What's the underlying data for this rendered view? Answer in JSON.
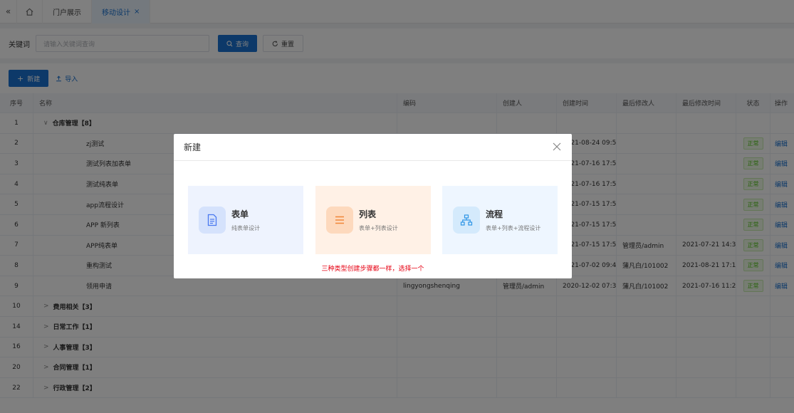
{
  "tabs": {
    "collapse_glyph": "«",
    "items": [
      {
        "label": "门户展示"
      },
      {
        "label": "移动设计",
        "close": "×"
      }
    ]
  },
  "search": {
    "label": "关键词",
    "placeholder": "请输入关键词查询",
    "query_button": "查询",
    "reset_button": "重置"
  },
  "actions": {
    "new_button": "新建",
    "import_link": "导入"
  },
  "table": {
    "headers": [
      "序号",
      "名称",
      "编码",
      "创建人",
      "创建时间",
      "最后修改人",
      "最后修改时间",
      "状态",
      "操作"
    ],
    "rows": [
      {
        "no": "1",
        "name": "仓库管理【8】",
        "type": "group",
        "expanded": true
      },
      {
        "no": "2",
        "name": "zj测试",
        "type": "child",
        "created": "2021-08-24 09:54",
        "status": "正常",
        "op": "编辑"
      },
      {
        "no": "3",
        "name": "测试列表加表单",
        "type": "child",
        "created": "2021-07-16 17:55",
        "status": "正常",
        "op": "编辑"
      },
      {
        "no": "4",
        "name": "测试纯表单",
        "type": "child",
        "created": "2021-07-16 17:54",
        "status": "正常",
        "op": "编辑"
      },
      {
        "no": "5",
        "name": "app流程设计",
        "type": "child",
        "created": "2021-07-15 17:58",
        "status": "正常",
        "op": "编辑"
      },
      {
        "no": "6",
        "name": "APP 新列表",
        "type": "child",
        "created": "2021-07-15 17:57",
        "status": "正常",
        "op": "编辑"
      },
      {
        "no": "7",
        "name": "APP纯表单",
        "type": "child",
        "created": "2021-07-15 17:56",
        "modifier": "管理员/admin",
        "modified": "2021-07-21 14:31",
        "status": "正常",
        "op": "编辑"
      },
      {
        "no": "8",
        "name": "重构测试",
        "type": "child",
        "created": "2021-07-02 09:40",
        "modifier": "蒲凡白/101002",
        "modified": "2021-08-21 17:11",
        "status": "正常",
        "op": "编辑"
      },
      {
        "no": "9",
        "name": "领用申请",
        "type": "child",
        "code": "lingyongshenqing",
        "creator": "管理员/admin",
        "created": "2020-12-02 07:39",
        "modifier": "蒲凡白/101002",
        "modified": "2021-07-16 11:26",
        "status": "正常",
        "op": "编辑"
      },
      {
        "no": "10",
        "name": "费用相关【3】",
        "type": "group"
      },
      {
        "no": "14",
        "name": "日常工作【1】",
        "type": "group"
      },
      {
        "no": "16",
        "name": "人事管理【3】",
        "type": "group"
      },
      {
        "no": "20",
        "name": "合同管理【1】",
        "type": "group"
      },
      {
        "no": "22",
        "name": "行政管理【2】",
        "type": "group"
      }
    ]
  },
  "modal": {
    "title": "新建",
    "cards": [
      {
        "title": "表单",
        "subtitle": "纯表单设计",
        "icon": "form-icon",
        "bg": "#eef3fe",
        "icon_bg": "#d5e2fc",
        "icon_color": "#4a79f0"
      },
      {
        "title": "列表",
        "subtitle": "表单+列表设计",
        "icon": "list-icon",
        "bg": "#fff1e6",
        "icon_bg": "#fdd9bd",
        "icon_color": "#f0873a"
      },
      {
        "title": "流程",
        "subtitle": "表单+列表+流程设计",
        "icon": "flow-icon",
        "bg": "#eef6ff",
        "icon_bg": "#d4eafc",
        "icon_color": "#2e95e6"
      }
    ],
    "hint": "三种类型创建步骤都一样，选择一个"
  },
  "colors": {
    "primary": "#1a73d2",
    "success": "#52c41a",
    "hint": "#e60012"
  }
}
